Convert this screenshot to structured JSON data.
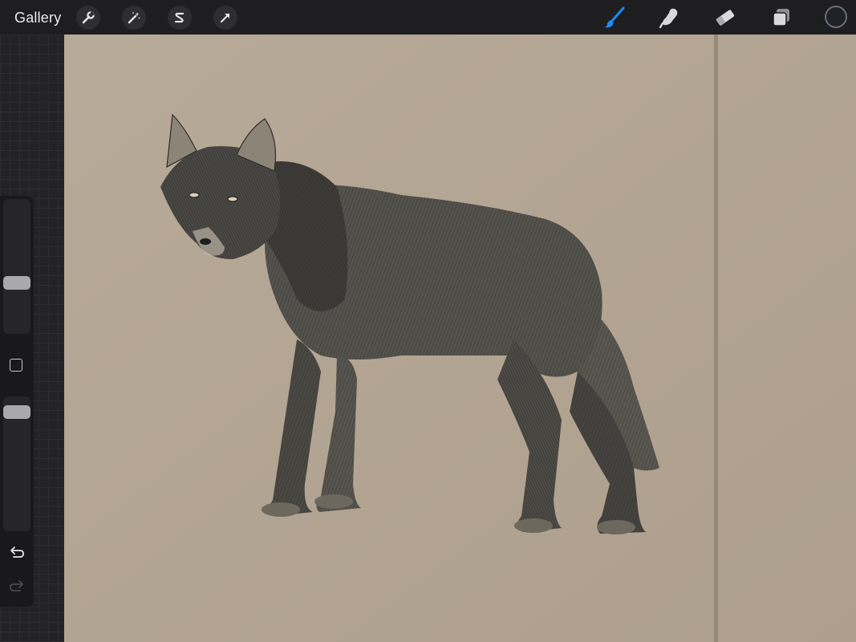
{
  "toolbar": {
    "gallery_label": "Gallery",
    "actions_icon": "wrench-icon",
    "adjustments_icon": "magic-wand-icon",
    "selection_icon": "selection-s-icon",
    "transform_icon": "arrow-cursor-icon",
    "brush_icon": "brush-icon",
    "smudge_icon": "smudge-finger-icon",
    "eraser_icon": "eraser-icon",
    "layers_icon": "layers-icon",
    "active_tool": "brush",
    "accent_color": "#1e8cf0",
    "current_color": "#1d2326"
  },
  "sidebar": {
    "brush_size_level": 0.36,
    "opacity_level": 0.95,
    "undo_icon": "undo-arrow-icon",
    "redo_icon": "redo-arrow-icon"
  },
  "canvas": {
    "paper_color": "#b4a694",
    "subject": "wolf-sketch"
  }
}
